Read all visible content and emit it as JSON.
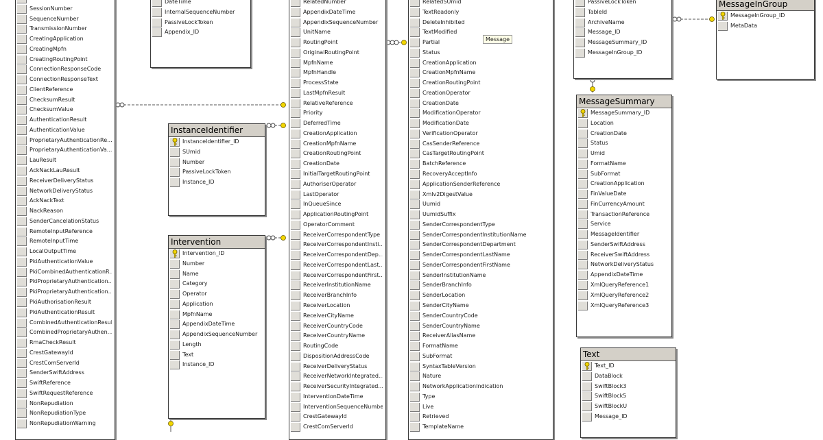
{
  "tables": {
    "transmission": {
      "rows": [
        "SessionHolder",
        "SessionNumber",
        "SequenceNumber",
        "TransmissionNumber",
        "CreatingApplication",
        "CreatingMpfn",
        "CreatingRoutingPoint",
        "ConnectionResponseCode",
        "ConnectionResponseText",
        "ClientReference",
        "ChecksumResult",
        "ChecksumValue",
        "AuthenticationResult",
        "AuthenticationValue",
        "ProprietaryAuthenticationRe...",
        "ProprietaryAuthenticationVa...",
        "LauResult",
        "AckNackLauResult",
        "ReceiverDeliveryStatus",
        "NetworkDeliveryStatus",
        "AckNackText",
        "NackReason",
        "SenderCancelationStatus",
        "RemoteInputReference",
        "RemoteInputTime",
        "LocalOutputTime",
        "PkiAuthenticationValue",
        "PkiCombinedAuthenticationR...",
        "PkiProprietaryAuthentication...",
        "PkiProprietaryAuthentication...",
        "PkiAuthorisationResult",
        "PkiAuthenticationResult",
        "CombinedAuthenticationResult",
        "CombinedProprietaryAuthen...",
        "RmaCheckResult",
        "CrestGatewayId",
        "CrestComServerId",
        "SenderSwiftAddress",
        "SwiftReference",
        "SwiftRequestReference",
        "NonRepudiation",
        "NonRepudiationType",
        "NonRepudiationWarning"
      ]
    },
    "small_top": {
      "rows": [
        "DateTime",
        "InternalSequenceNumber",
        "PassiveLockToken",
        "Appendix_ID"
      ]
    },
    "instance_identifier": {
      "title": "InstanceIdentifier",
      "rows": [
        "InstanceIdentifier_ID",
        "SUmid",
        "Number",
        "PassiveLockToken",
        "Instance_ID"
      ]
    },
    "intervention": {
      "title": "Intervention",
      "rows": [
        "Intervention_ID",
        "Number",
        "Name",
        "Category",
        "Operator",
        "Application",
        "MpfnName",
        "AppendixDateTime",
        "AppendixSequenceNumber",
        "Length",
        "Text",
        "Instance_ID"
      ]
    },
    "instance": {
      "rows": [
        "RelatedNumber",
        "AppendixDateTime",
        "AppendixSequenceNumber",
        "UnitName",
        "RoutingPoint",
        "OriginalRoutingPoint",
        "MpfnName",
        "MpfnHandle",
        "ProcessState",
        "LastMpfnResult",
        "RelativeReference",
        "Priority",
        "DeferredTime",
        "CreationApplication",
        "CreationMpfnName",
        "CreationRoutingPoint",
        "CreationDate",
        "InitialTargetRoutingPoint",
        "AuthoriserOperator",
        "LastOperator",
        "InQueueSince",
        "ApplicationRoutingPoint",
        "OperatorComment",
        "ReceiverCorrespondentType",
        "ReceiverCorrespondentInsti...",
        "ReceiverCorrespondentDep...",
        "ReceiverCorrespondentLast...",
        "ReceiverCorrespondentFirst...",
        "ReceiverInstitutionName",
        "ReceiverBranchInfo",
        "ReceiverLocation",
        "ReceiverCityName",
        "ReceiverCountryCode",
        "ReceiverCountryName",
        "RoutingCode",
        "DispositionAddressCode",
        "ReceiverDeliveryStatus",
        "ReceiverNetworkIntegrated...",
        "ReceiverSecurityIntegrated...",
        "InterventionDateTime",
        "InterventionSequenceNumber",
        "CrestGatewayId",
        "CrestComServerId"
      ]
    },
    "message": {
      "rows": [
        "RelatedSUmid",
        "TextReadonly",
        "DeleteInhibited",
        "TextModified",
        "Partial",
        "Status",
        "CreationApplication",
        "CreationMpfnName",
        "CreationRoutingPoint",
        "CreationOperator",
        "CreationDate",
        "ModificationOperator",
        "ModificationDate",
        "VerificationOperator",
        "CasSenderReference",
        "CasTargetRoutingPoint",
        "BatchReference",
        "RecoveryAcceptInfo",
        "ApplicationSenderReference",
        "Xmlv2DigestValue",
        "Uumid",
        "UumidSuffix",
        "SenderCorrespondentType",
        "SenderCorrespondentInstitutionName",
        "SenderCorrespondentDepartment",
        "SenderCorrespondentLastName",
        "SenderCorrespondentFirstName",
        "SenderInstitutionName",
        "SenderBranchInfo",
        "SenderLocation",
        "SenderCityName",
        "SenderCountryCode",
        "SenderCountryName",
        "ReceiverAliasName",
        "FormatName",
        "SubFormat",
        "SyntaxTableVersion",
        "Nature",
        "NetworkApplicationIndication",
        "Type",
        "Live",
        "Retrieved",
        "TemplateName"
      ]
    },
    "archive": {
      "rows": [
        "PassiveLockToken",
        "TableId",
        "ArchiveName",
        "Message_ID",
        "MessageSummary_ID",
        "MessageInGroup_ID"
      ]
    },
    "message_in_group": {
      "title": "MessageInGroup",
      "rows": [
        "MessageInGroup_ID",
        "MetaData"
      ]
    },
    "message_summary": {
      "title": "MessageSummary",
      "rows": [
        "MessageSummary_ID",
        "Location",
        "CreationDate",
        "Status",
        "Umid",
        "FormatName",
        "SubFormat",
        "CreationApplication",
        "FinValueDate",
        "FinCurrencyAmount",
        "TransactionReference",
        "Service",
        "MessageIdentifier",
        "SenderSwiftAddress",
        "ReceiverSwiftAddress",
        "NetworkDeliveryStatus",
        "AppendixDateTime",
        "XmlQueryReference1",
        "XmlQueryReference2",
        "XmlQueryReference3"
      ]
    },
    "text": {
      "title": "Text",
      "rows": [
        "Text_ID",
        "DataBlock",
        "SwiftBlock3",
        "SwiftBlock5",
        "SwiftBlockU",
        "Message_ID"
      ]
    }
  },
  "callout": {
    "label": "Message"
  },
  "colors": {
    "title_bar": "#d4d0c8",
    "key": "#f2d600",
    "connector": "#555555"
  }
}
